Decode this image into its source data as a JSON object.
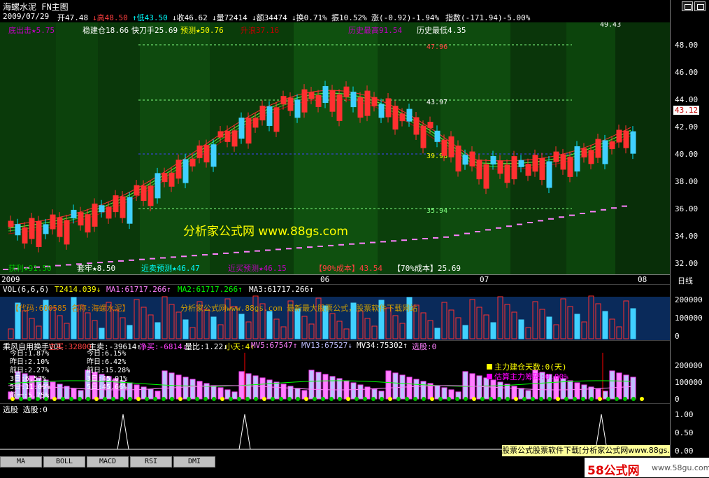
{
  "header": {
    "title": "海螺水泥 FN主图",
    "info": [
      {
        "t": "2009/07/29",
        "c": "#ffffff"
      },
      {
        "t": "开47.48",
        "c": "#ffffff"
      },
      {
        "t": "↓高48.50",
        "c": "#ff4040"
      },
      {
        "t": "↑低43.50",
        "c": "#00ffff"
      },
      {
        "t": "↓收46.62",
        "c": "#ffffff"
      },
      {
        "t": "↓量72414",
        "c": "#ffffff"
      },
      {
        "t": "↓额34474",
        "c": "#ffffff"
      },
      {
        "t": "↓换0.71%",
        "c": "#ffffff"
      },
      {
        "t": "振10.52%",
        "c": "#ffffff"
      },
      {
        "t": "涨(-0.92)-1.94%",
        "c": "#ffffff"
      },
      {
        "t": "指数(-171.94)-5.00%",
        "c": "#ffffff"
      }
    ]
  },
  "main": {
    "top_labels": [
      {
        "t": "底出击★5.75",
        "c": "#c000c0"
      },
      {
        "t": "稳建仓18.66",
        "c": "#ffffff"
      },
      {
        "t": "快刀手25.69",
        "c": "#ffffff"
      },
      {
        "t": "预测★50.76",
        "c": "#ffff00"
      },
      {
        "t": "升浪37.16",
        "c": "#c00000"
      },
      {
        "t": "历史最高91.54",
        "c": "#c000c0"
      },
      {
        "t": "历史最低4.35",
        "c": "#ffffff"
      }
    ],
    "bottom_labels": [
      {
        "t": "获利★91.50",
        "c": "#00c000"
      },
      {
        "t": "套牢★8.50",
        "c": "#ffffff"
      },
      {
        "t": "近卖预测★46.47",
        "c": "#00ffff"
      },
      {
        "t": "近买预测★46.15",
        "c": "#c000c0"
      },
      {
        "t": "【90%成本】43.54",
        "c": "#ff4040"
      },
      {
        "t": "【70%成本】25.69",
        "c": "#ffffff"
      }
    ],
    "peak_label": "49.43",
    "level_labels": [
      "47.96",
      "43.97",
      "39.96",
      "35.94"
    ],
    "watermark": "分析家公式网 www.88gs.com",
    "price_ticks": [
      "48.00",
      "46.00",
      "44.00",
      "42.00",
      "40.00",
      "38.00",
      "36.00",
      "34.00",
      "32.00"
    ],
    "current_price": "43.12",
    "date_labels": [
      "2009",
      "06",
      "07",
      "08"
    ],
    "date_axis_label": "日线"
  },
  "vol": {
    "header": [
      {
        "t": "VOL(6,6,6)",
        "c": "#ffffff"
      },
      {
        "t": "T2414.039↓",
        "c": "#ffff00"
      },
      {
        "t": "MA1:61717.266↑",
        "c": "#ff80ff"
      },
      {
        "t": "MA2:61717.266↑",
        "c": "#00ff00"
      },
      {
        "t": "MA3:61717.266↑",
        "c": "#ffffff"
      }
    ],
    "overlay_code": "【代码:600585 名称:海螺水泥】",
    "overlay_site": "分析家公式网www.88gs.com 最新最大股票公式，股票软件下载网站",
    "ticks": [
      "200000",
      "100000",
      "0"
    ]
  },
  "ind": {
    "header": [
      {
        "t": "乘风自用换手VOL",
        "c": "#ffffff"
      },
      {
        "t": "主买:32800",
        "c": "#ff4040"
      },
      {
        "t": "主卖:-39614↑",
        "c": "#ffffff"
      },
      {
        "t": "净买:-6814↓",
        "c": "#ff40ff"
      },
      {
        "t": "量比:1.22↓",
        "c": "#ffffff"
      },
      {
        "t": "小天:4↑",
        "c": "#ffff00"
      },
      {
        "t": "MV5:67547↑",
        "c": "#ff80ff"
      },
      {
        "t": "MV13:67527↓",
        "c": "#c0c0ff"
      },
      {
        "t": "MV34:75302↑",
        "c": "#ffffff"
      },
      {
        "t": "选股:0",
        "c": "#ff80ff"
      }
    ],
    "overlay_left": [
      "今日:1.87%",
      "昨日:2.10%",
      "前日:2.27%",
      "3日:6.57%",
      "5日:11.09%",
      "前一:5.75%"
    ],
    "overlay_mid": [
      "今日:6.15%",
      "昨日:6.42%",
      "前日:15.28%",
      "3日:45.01%",
      "5日:45.66%"
    ],
    "signal1": "主力建仓天数:0(天)",
    "signal2": "估算主力筹码:0.00%",
    "ticks": [
      "200000",
      "100000",
      "0"
    ]
  },
  "sel": {
    "header": "选股 选股:0",
    "ticks": [
      "1.00",
      "0.50",
      "0.00"
    ]
  },
  "tabs": [
    "MA",
    "BOLL",
    "MACD",
    "RSI",
    "DMI"
  ],
  "footer_ad": "股票公式股票软件下载[分析家公式网www.88gs.com]",
  "brand": {
    "name": "58公式网",
    "url": "www.58gu.com"
  }
}
